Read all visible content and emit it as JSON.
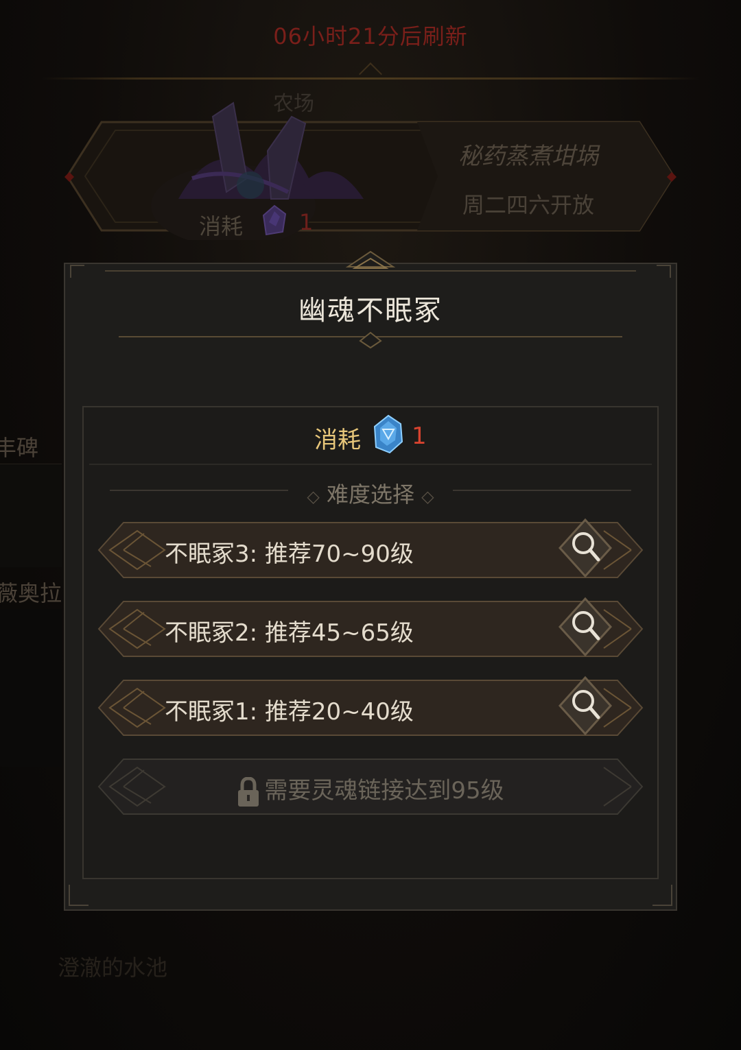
{
  "header": {
    "refresh_text": "06小时21分后刷新",
    "location": "农场"
  },
  "event_card": {
    "title": "秘药蒸煮坩埚",
    "schedule": "周二四六开放",
    "cost_label": "消耗",
    "cost_value": "1"
  },
  "background_labels": {
    "left_1": "丰碑",
    "left_2": "薇奥拉",
    "bottom_left": "澄澈的水池"
  },
  "dialog": {
    "title": "幽魂不眠冢",
    "cost_label": "消耗",
    "cost_value": "1",
    "difficulty_header": "难度选择",
    "options": [
      {
        "label": "不眠冢3: 推荐70~90级",
        "locked": false
      },
      {
        "label": "不眠冢2: 推荐45~65级",
        "locked": false
      },
      {
        "label": "不眠冢1: 推荐20~40级",
        "locked": false
      }
    ],
    "locked_option": "需要灵魂链接达到95级"
  },
  "colors": {
    "accent_gold": "#e8c77a",
    "cost_red": "#d7432f",
    "refresh_red": "#7a1f1a",
    "row_bg": "#302720",
    "row_border": "#5a4a36"
  },
  "icons": [
    "purple-gem-icon",
    "blue-crystal-icon",
    "search-icon",
    "lock-icon"
  ]
}
